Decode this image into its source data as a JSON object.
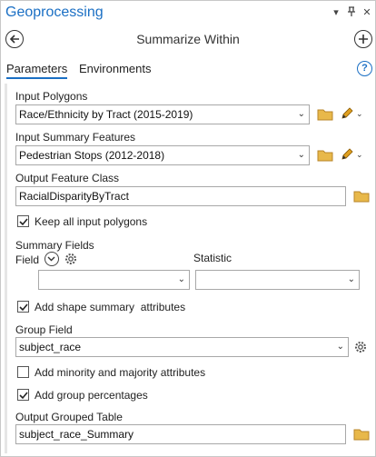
{
  "window": {
    "title": "Geoprocessing",
    "controls": [
      "chevron-down-icon",
      "pin-icon",
      "close-icon"
    ]
  },
  "header": {
    "tool_title": "Summarize Within",
    "back_icon": "back-arrow-icon",
    "add_icon": "add-icon"
  },
  "tabs": {
    "parameters": "Parameters",
    "environments": "Environments",
    "help_glyph": "?"
  },
  "form": {
    "input_polygons": {
      "label": "Input Polygons",
      "value": "Race/Ethnicity by Tract (2015-2019)"
    },
    "input_summary_features": {
      "label": "Input Summary Features",
      "value": "Pedestrian Stops (2012-2018)"
    },
    "output_feature_class": {
      "label": "Output Feature Class",
      "value": "RacialDisparityByTract"
    },
    "keep_all_input_polygons": {
      "label": "Keep all input polygons",
      "checked": true
    },
    "summary_fields": {
      "label": "Summary Fields",
      "field_label": "Field",
      "statistic_label": "Statistic",
      "field_value": "",
      "statistic_value": ""
    },
    "add_shape_summary": {
      "label": "Add shape summary  attributes",
      "checked": true
    },
    "group_field": {
      "label": "Group Field",
      "value": "subject_race"
    },
    "add_minority_majority": {
      "label": "Add minority and majority attributes",
      "checked": false
    },
    "add_group_percentages": {
      "label": "Add group percentages",
      "checked": true
    },
    "output_grouped_table": {
      "label": "Output Grouped Table",
      "value": "subject_race_Summary"
    }
  },
  "colors": {
    "accent": "#1a6fc4",
    "folder": "#e8b84a",
    "pencil": "#e0a020"
  }
}
